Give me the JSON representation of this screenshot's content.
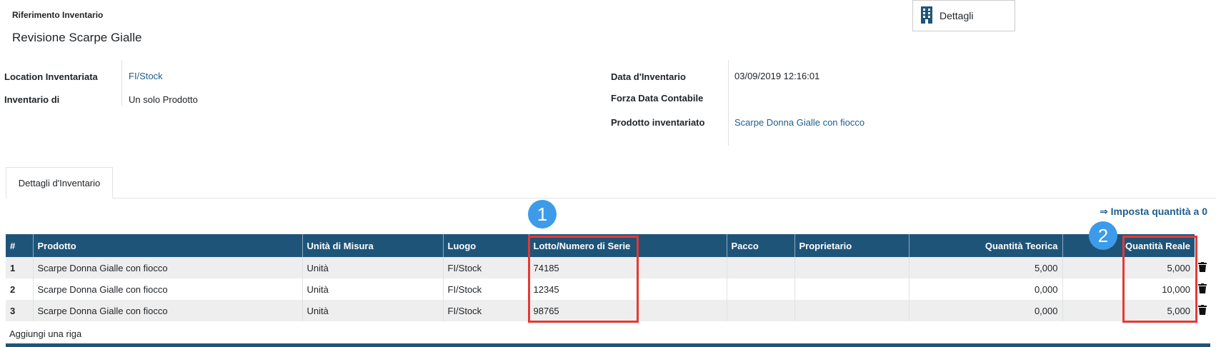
{
  "header": {
    "ref_label": "Riferimento Inventario",
    "ref_name": "Revisione Scarpe Gialle",
    "details_button": "Dettagli"
  },
  "fields": {
    "location_label": "Location Inventariata",
    "location_value": "FI/Stock",
    "inventory_of_label": "Inventario di",
    "inventory_of_value": "Un solo Prodotto",
    "date_label": "Data d'Inventario",
    "date_value": "03/09/2019 12:16:01",
    "force_date_label": "Forza Data Contabile",
    "force_date_value": "",
    "product_label": "Prodotto inventariato",
    "product_value": "Scarpe Donna Gialle con fiocco"
  },
  "tabs": [
    {
      "label": "Dettagli d'Inventario"
    }
  ],
  "actions": {
    "set_zero": "⇒ Imposta quantità a 0",
    "add_line": "Aggiungi una riga"
  },
  "table": {
    "columns": [
      "#",
      "Prodotto",
      "Unità di Misura",
      "Luogo",
      "Lotto/Numero di Serie",
      "Pacco",
      "Proprietario",
      "Quantità Teorica",
      "Quantità Reale"
    ],
    "rows": [
      {
        "n": "1",
        "product": "Scarpe Donna Gialle con fiocco",
        "uom": "Unità",
        "location": "FI/Stock",
        "lot": "74185",
        "package": "",
        "owner": "",
        "theoretical": "5,000",
        "real": "5,000"
      },
      {
        "n": "2",
        "product": "Scarpe Donna Gialle con fiocco",
        "uom": "Unità",
        "location": "FI/Stock",
        "lot": "12345",
        "package": "",
        "owner": "",
        "theoretical": "0,000",
        "real": "10,000"
      },
      {
        "n": "3",
        "product": "Scarpe Donna Gialle con fiocco",
        "uom": "Unità",
        "location": "FI/Stock",
        "lot": "98765",
        "package": "",
        "owner": "",
        "theoretical": "0,000",
        "real": "5,000"
      }
    ]
  },
  "annotations": {
    "badge_1": "1",
    "badge_2": "2",
    "highlight_color": "#e53935",
    "badge_color": "#3d9be9"
  },
  "icons": {
    "details_button_icon": "building-icon",
    "row_delete_icon": "trash-icon"
  },
  "colors": {
    "header_bg": "#1f5479",
    "link": "#1f5e8c"
  }
}
